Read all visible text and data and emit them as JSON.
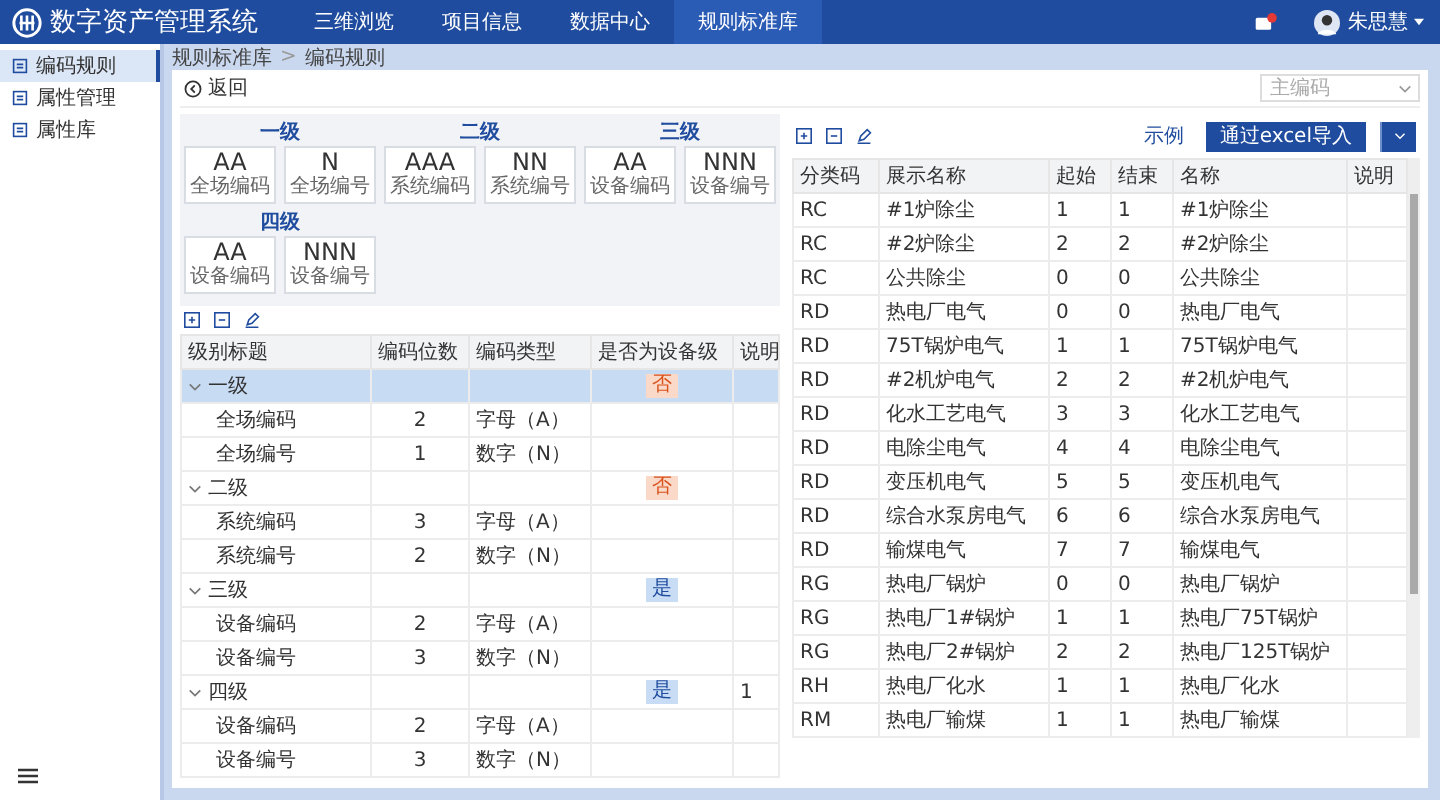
{
  "top_bar": {
    "title": "数字资产管理系统",
    "nav": [
      {
        "label": "三维浏览",
        "selected": false
      },
      {
        "label": "项目信息",
        "selected": false
      },
      {
        "label": "数据中心",
        "selected": false
      },
      {
        "label": "规则标准库",
        "selected": true
      }
    ],
    "user": {
      "name": "朱思慧"
    }
  },
  "sidebar": {
    "items": [
      {
        "label": "编码规则",
        "selected": true
      },
      {
        "label": "属性管理",
        "selected": false
      },
      {
        "label": "属性库",
        "selected": false
      }
    ]
  },
  "breadcrumb": {
    "items": [
      "规则标准库",
      "编码规则"
    ],
    "separator": ">"
  },
  "back_button": "返回",
  "code_select": {
    "placeholder": "主编码"
  },
  "levels": [
    {
      "title": "一级",
      "segments": [
        {
          "code": "AA",
          "label": "全场编码"
        },
        {
          "code": "N",
          "label": "全场编号"
        }
      ]
    },
    {
      "title": "二级",
      "segments": [
        {
          "code": "AAA",
          "label": "系统编码"
        },
        {
          "code": "NN",
          "label": "系统编号"
        }
      ]
    },
    {
      "title": "三级",
      "segments": [
        {
          "code": "AA",
          "label": "设备编码"
        },
        {
          "code": "NNN",
          "label": "设备编号"
        }
      ]
    },
    {
      "title": "四级",
      "segments": [
        {
          "code": "AA",
          "label": "设备编码"
        },
        {
          "code": "NNN",
          "label": "设备编号"
        }
      ]
    }
  ],
  "left_table": {
    "columns": [
      "级别标题",
      "编码位数",
      "编码类型",
      "是否为设备级",
      "说明"
    ],
    "rows": [
      {
        "title": "一级",
        "expanded": true,
        "selected": true,
        "device_level": {
          "text": "否",
          "is_device": false
        },
        "note": "",
        "children": [
          {
            "title": "全场编码",
            "digits": "2",
            "type": "字母（A）"
          },
          {
            "title": "全场编号",
            "digits": "1",
            "type": "数字（N）"
          }
        ]
      },
      {
        "title": "二级",
        "expanded": true,
        "selected": false,
        "device_level": {
          "text": "否",
          "is_device": false
        },
        "note": "",
        "children": [
          {
            "title": "系统编码",
            "digits": "3",
            "type": "字母（A）"
          },
          {
            "title": "系统编号",
            "digits": "2",
            "type": "数字（N）"
          }
        ]
      },
      {
        "title": "三级",
        "expanded": true,
        "selected": false,
        "device_level": {
          "text": "是",
          "is_device": true
        },
        "note": "",
        "children": [
          {
            "title": "设备编码",
            "digits": "2",
            "type": "字母（A）"
          },
          {
            "title": "设备编号",
            "digits": "3",
            "type": "数字（N）"
          }
        ]
      },
      {
        "title": "四级",
        "expanded": true,
        "selected": false,
        "device_level": {
          "text": "是",
          "is_device": true
        },
        "note": "1",
        "children": [
          {
            "title": "设备编码",
            "digits": "2",
            "type": "字母（A）"
          },
          {
            "title": "设备编号",
            "digits": "3",
            "type": "数字（N）"
          }
        ]
      }
    ]
  },
  "right_panel": {
    "example_link": "示例",
    "import_button": "通过excel导入"
  },
  "right_table": {
    "columns": [
      "分类码",
      "展示名称",
      "起始",
      "结束",
      "名称",
      "说明"
    ],
    "rows": [
      [
        "RC",
        "#1炉除尘",
        "1",
        "1",
        "#1炉除尘"
      ],
      [
        "RC",
        "#2炉除尘",
        "2",
        "2",
        "#2炉除尘"
      ],
      [
        "RC",
        "公共除尘",
        "0",
        "0",
        "公共除尘"
      ],
      [
        "RD",
        "热电厂电气",
        "0",
        "0",
        "热电厂电气"
      ],
      [
        "RD",
        "75T锅炉电气",
        "1",
        "1",
        "75T锅炉电气"
      ],
      [
        "RD",
        "#2机炉电气",
        "2",
        "2",
        "#2机炉电气"
      ],
      [
        "RD",
        "化水工艺电气",
        "3",
        "3",
        "化水工艺电气"
      ],
      [
        "RD",
        "电除尘电气",
        "4",
        "4",
        "电除尘电气"
      ],
      [
        "RD",
        "变压机电气",
        "5",
        "5",
        "变压机电气"
      ],
      [
        "RD",
        "综合水泵房电气",
        "6",
        "6",
        "综合水泵房电气"
      ],
      [
        "RD",
        "输煤电气",
        "7",
        "7",
        "输煤电气"
      ],
      [
        "RG",
        "热电厂锅炉",
        "0",
        "0",
        "热电厂锅炉"
      ],
      [
        "RG",
        "热电厂1#锅炉",
        "1",
        "1",
        "热电厂75T锅炉"
      ],
      [
        "RG",
        "热电厂2#锅炉",
        "2",
        "2",
        "热电厂125T锅炉"
      ],
      [
        "RH",
        "热电厂化水",
        "1",
        "1",
        "热电厂化水"
      ],
      [
        "RM",
        "热电厂输煤",
        "1",
        "1",
        "热电厂输煤"
      ]
    ]
  }
}
